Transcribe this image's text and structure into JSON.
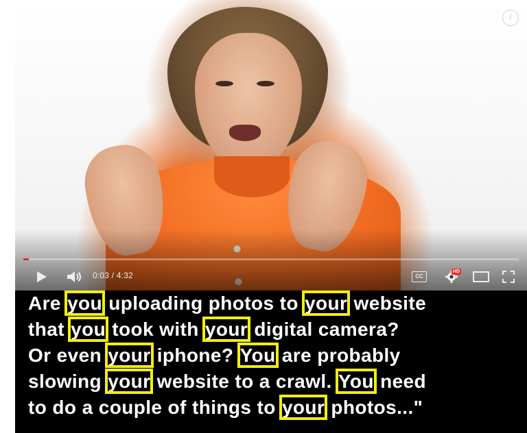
{
  "player": {
    "current_time": "0:03",
    "separator": " / ",
    "duration": "4:32",
    "progress_fraction": 0.011,
    "info_glyph": "i",
    "cc_label": "CC",
    "hd_badge": "HD",
    "icons": [
      "info-icon",
      "play-icon",
      "volume-icon",
      "subtitles-icon",
      "settings-gear-icon",
      "theater-mode-icon",
      "fullscreen-icon"
    ],
    "accent_color": "#f12b24"
  },
  "caption": {
    "highlight_color": "#f1f00c",
    "lines": [
      [
        {
          "t": "Are ",
          "hl": false
        },
        {
          "t": "you",
          "hl": true
        },
        {
          "t": " uploading photos to ",
          "hl": false
        },
        {
          "t": "your",
          "hl": true
        },
        {
          "t": " website",
          "hl": false
        }
      ],
      [
        {
          "t": "that ",
          "hl": false
        },
        {
          "t": "you",
          "hl": true
        },
        {
          "t": " took with ",
          "hl": false
        },
        {
          "t": "your",
          "hl": true
        },
        {
          "t": " digital camera?",
          "hl": false
        }
      ],
      [
        {
          "t": "Or even ",
          "hl": false
        },
        {
          "t": "your",
          "hl": true
        },
        {
          "t": " iphone? ",
          "hl": false
        },
        {
          "t": "You",
          "hl": true
        },
        {
          "t": " are probably",
          "hl": false
        }
      ],
      [
        {
          "t": "slowing ",
          "hl": false
        },
        {
          "t": "your",
          "hl": true
        },
        {
          "t": " website to a crawl. ",
          "hl": false
        },
        {
          "t": "You",
          "hl": true
        },
        {
          "t": " need",
          "hl": false
        }
      ],
      [
        {
          "t": "to do a couple of things to ",
          "hl": false
        },
        {
          "t": "your",
          "hl": true
        },
        {
          "t": " photos...\"",
          "hl": false
        }
      ]
    ]
  }
}
